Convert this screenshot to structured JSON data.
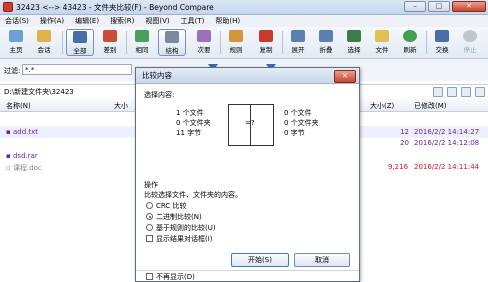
{
  "window": {
    "title": "32423 <--> 43423 - 文件夹比较(F) - Beyond Compare"
  },
  "menu": [
    "会话(S)",
    "操作(A)",
    "编辑(E)",
    "搜索(R)",
    "视图(V)",
    "工具(T)",
    "帮助(H)"
  ],
  "toolbar": {
    "home": "主页",
    "session": "会话",
    "all": "全部",
    "diff": "差别",
    "same": "相同",
    "structure": "结构",
    "next": "次要",
    "rules": "规则",
    "copy": "复制",
    "expand": "展开",
    "collapse": "折叠",
    "select": "选择",
    "files": "文件",
    "refresh": "刷新",
    "swap": "交换",
    "stop": "停止"
  },
  "filter": {
    "label": "过滤:",
    "value": "*.*"
  },
  "left_path": "D:\\新建文件夹\\32423",
  "columns": {
    "name": "名称(N)",
    "size_left": "大小",
    "size_right": "大小(Z)",
    "modified": "已修改(M)"
  },
  "rows": [
    {
      "name": "add.txt",
      "size": "12",
      "modified": "2016/2/2 14:14:27"
    },
    {
      "name": "",
      "size": "20",
      "modified": "2016/2/2 14:12:08"
    },
    {
      "name": "dsd.rar",
      "size": "",
      "modified": ""
    },
    {
      "name": "课程.doc",
      "size": "9,216",
      "modified": "2016/2/2 14:11:44"
    }
  ],
  "dialog": {
    "title": "比较内容",
    "close_label": "✕",
    "section_select": "选择内容:",
    "left_stats": [
      "1 个文件",
      "0 个文件夹",
      "11 字节"
    ],
    "right_stats": [
      "0 个文件",
      "0 个文件夹",
      "0 字节"
    ],
    "compare_symbol": "=?",
    "section_ops": "操作",
    "ops_desc": "比较选择文件、文件夹的内容。",
    "options": {
      "crc": "CRC 比较",
      "binary": "二进制比较(N)",
      "rules": "基于规则的比较(U)"
    },
    "show_result": "显示结果对话框(I)",
    "start": "开始(S)",
    "cancel": "取消",
    "dont_show": "不再显示(D)"
  }
}
